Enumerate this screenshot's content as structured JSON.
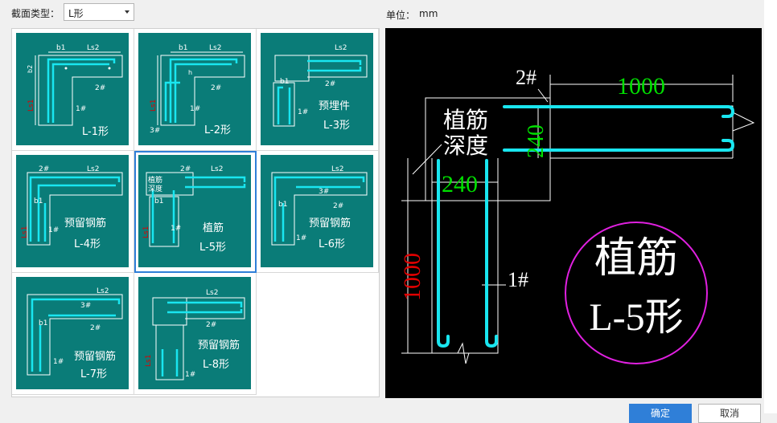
{
  "header": {
    "section_type_label": "截面类型：",
    "section_type_value": "L形",
    "unit_label": "单位：",
    "unit_value": "mm"
  },
  "tiles": [
    {
      "id": "L-1",
      "name": "L-1形"
    },
    {
      "id": "L-2",
      "name": "L-2形"
    },
    {
      "id": "L-3",
      "name": "L-3形",
      "sub": "预埋件"
    },
    {
      "id": "L-4",
      "name": "L-4形",
      "sub": "预留钢筋"
    },
    {
      "id": "L-5",
      "name": "L-5形",
      "sub": "植筋",
      "selected": true
    },
    {
      "id": "L-6",
      "name": "L-6形",
      "sub": "预留钢筋"
    },
    {
      "id": "L-7",
      "name": "L-7形",
      "sub": "预留钢筋"
    },
    {
      "id": "L-8",
      "name": "L-8形",
      "sub": "预留钢筋"
    }
  ],
  "tile_labels": {
    "b1": "b1",
    "b2": "b2",
    "ls2": "Ls2",
    "ls1": "Ls1",
    "h": "h",
    "r1": "1#",
    "r2": "2#",
    "r3": "3#",
    "zhijin": "植筋",
    "shendu": "深度"
  },
  "preview": {
    "label_2": "2#",
    "dim_top": "1000",
    "dim_240_v": "240",
    "zhijin": "植筋",
    "shendu": "深度",
    "dim_240_h": "240",
    "dim_left": "1000",
    "label_1": "1#",
    "circle_line1": "植筋",
    "circle_line2": "L-5形"
  },
  "buttons": {
    "ok": "确定",
    "cancel": "取消"
  },
  "colors": {
    "tile_bg": "#0a7c78",
    "rebar": "#19e6f0",
    "dim_green": "#00e000",
    "dim_red": "#e00000",
    "circle": "#e020e0",
    "selected_border": "#2f7fd8"
  }
}
